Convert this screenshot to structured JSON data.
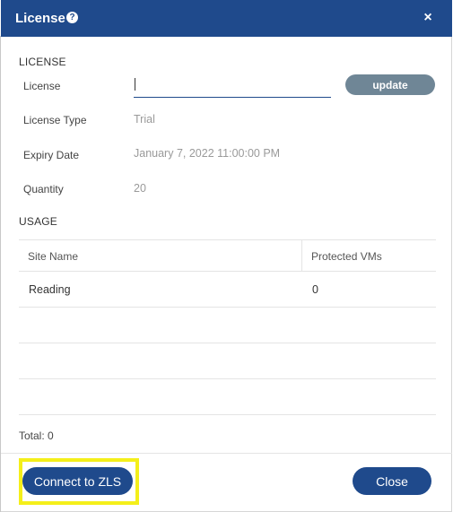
{
  "dialog": {
    "title": "License",
    "help_icon": "?",
    "close_icon": "×"
  },
  "license_section": {
    "title": "LICENSE",
    "fields": {
      "license_label": "License",
      "license_value": "",
      "update_label": "update",
      "type_label": "License Type",
      "type_value": "Trial",
      "expiry_label": "Expiry Date",
      "expiry_value": "January 7, 2022 11:00:00 PM",
      "quantity_label": "Quantity",
      "quantity_value": "20"
    }
  },
  "usage_section": {
    "title": "USAGE",
    "columns": [
      "Site Name",
      "Protected VMs"
    ],
    "rows": [
      [
        "Reading",
        "0"
      ],
      [
        "",
        ""
      ],
      [
        "",
        ""
      ],
      [
        "",
        ""
      ]
    ],
    "total_label": "Total:",
    "total_value": "0"
  },
  "footer": {
    "connect_label": "Connect to ZLS",
    "close_label": "Close"
  },
  "colors": {
    "header": "#1f4a8c",
    "primary_button": "#1f4a8c",
    "update_button": "#6f8696",
    "highlight": "#f4ef1a"
  }
}
